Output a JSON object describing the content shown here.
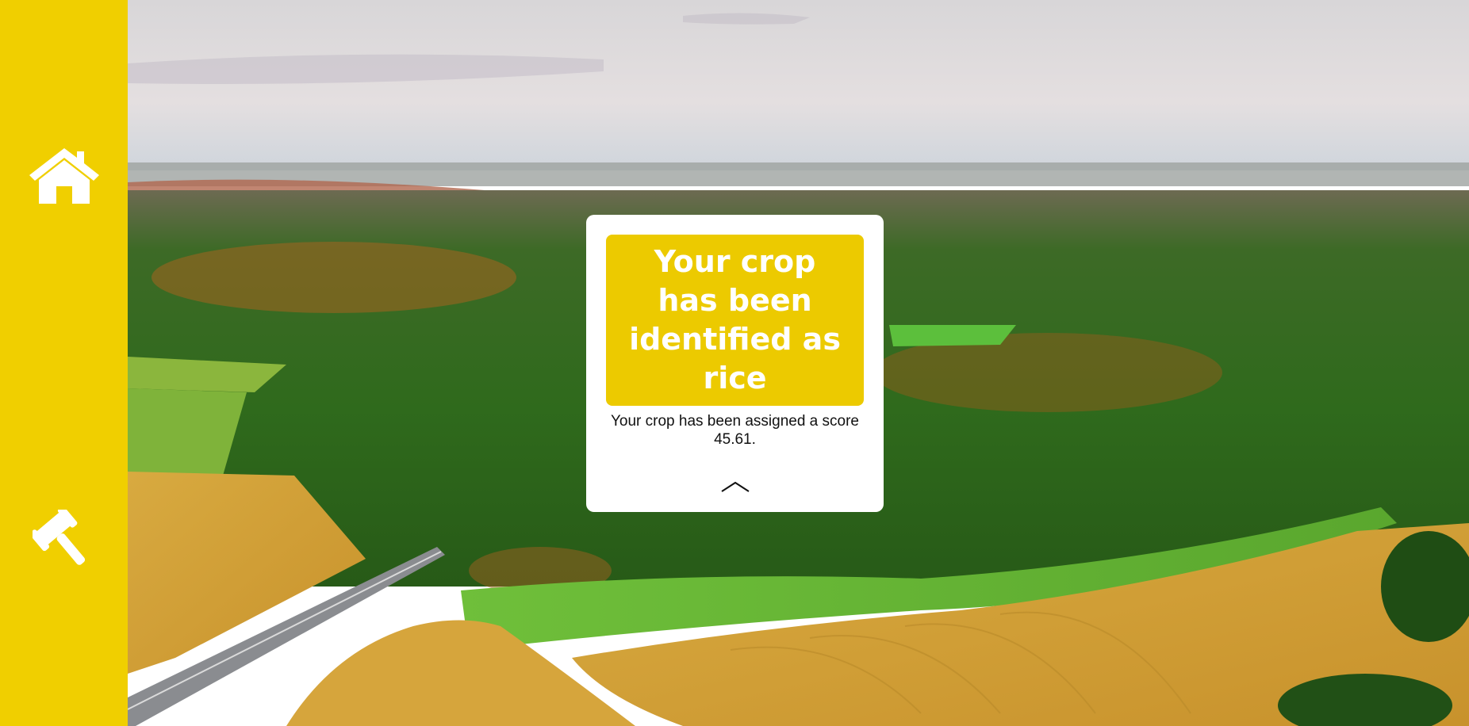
{
  "sidebar": {
    "items": [
      {
        "icon": "home-icon",
        "label": "Home"
      },
      {
        "icon": "gavel-icon",
        "label": "Gavel"
      }
    ],
    "color": "#f0cf00"
  },
  "result_card": {
    "title": "Your crop has been identified as rice",
    "score_text": "Your crop has been assigned a score 45.61.",
    "banner_color": "#ecca00",
    "collapse_icon": "chevron-up-icon"
  },
  "background": {
    "subject": "aerial landscape"
  }
}
